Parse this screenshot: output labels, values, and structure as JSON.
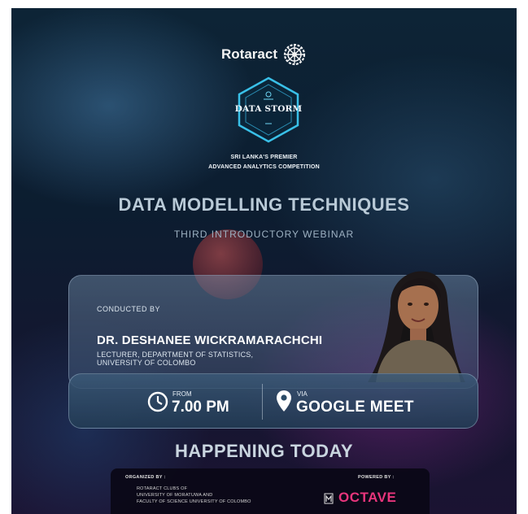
{
  "header": {
    "org_name": "Rotaract",
    "event_logo_text": "DATA STORM",
    "tagline_line1": "SRI LANKA'S PREMIER",
    "tagline_line2": "ADVANCED ANALYTICS COMPETITION"
  },
  "title": "DATA MODELLING TECHNIQUES",
  "subtitle": "THIRD INTRODUCTORY WEBINAR",
  "speaker_card": {
    "conducted_by_label": "CONDUCTED BY",
    "speaker_name": "DR. DESHANEE WICKRAMARACHCHI",
    "role_line1": "LECTURER, DEPARTMENT OF STATISTICS,",
    "role_line2": "UNIVERSITY OF COLOMBO"
  },
  "info": {
    "time_label": "FROM",
    "time_value": "7.00 PM",
    "platform_label": "VIA",
    "platform_value": "GOOGLE MEET"
  },
  "banner": "HAPPENING TODAY",
  "footer": {
    "organized_label": "ORGANIZED BY :",
    "organizer_line1": "ROTARACT CLUBS OF",
    "organizer_line2": "UNIVERSITY OF MORATUWA AND",
    "organizer_line3": "FACULTY OF SCIENCE UNIVERSITY OF COLOMBO",
    "powered_label": "POWERED BY :",
    "sponsor": "OCTAVE"
  },
  "icons": [
    "rotary-wheel-icon",
    "data-storm-hex-logo",
    "clock-icon",
    "location-pin-icon",
    "university-crest-icon"
  ],
  "colors": {
    "background": "#0c1d30",
    "title": "#b9cad7",
    "sponsor": "#e8357c",
    "card": "#4f6b88"
  }
}
